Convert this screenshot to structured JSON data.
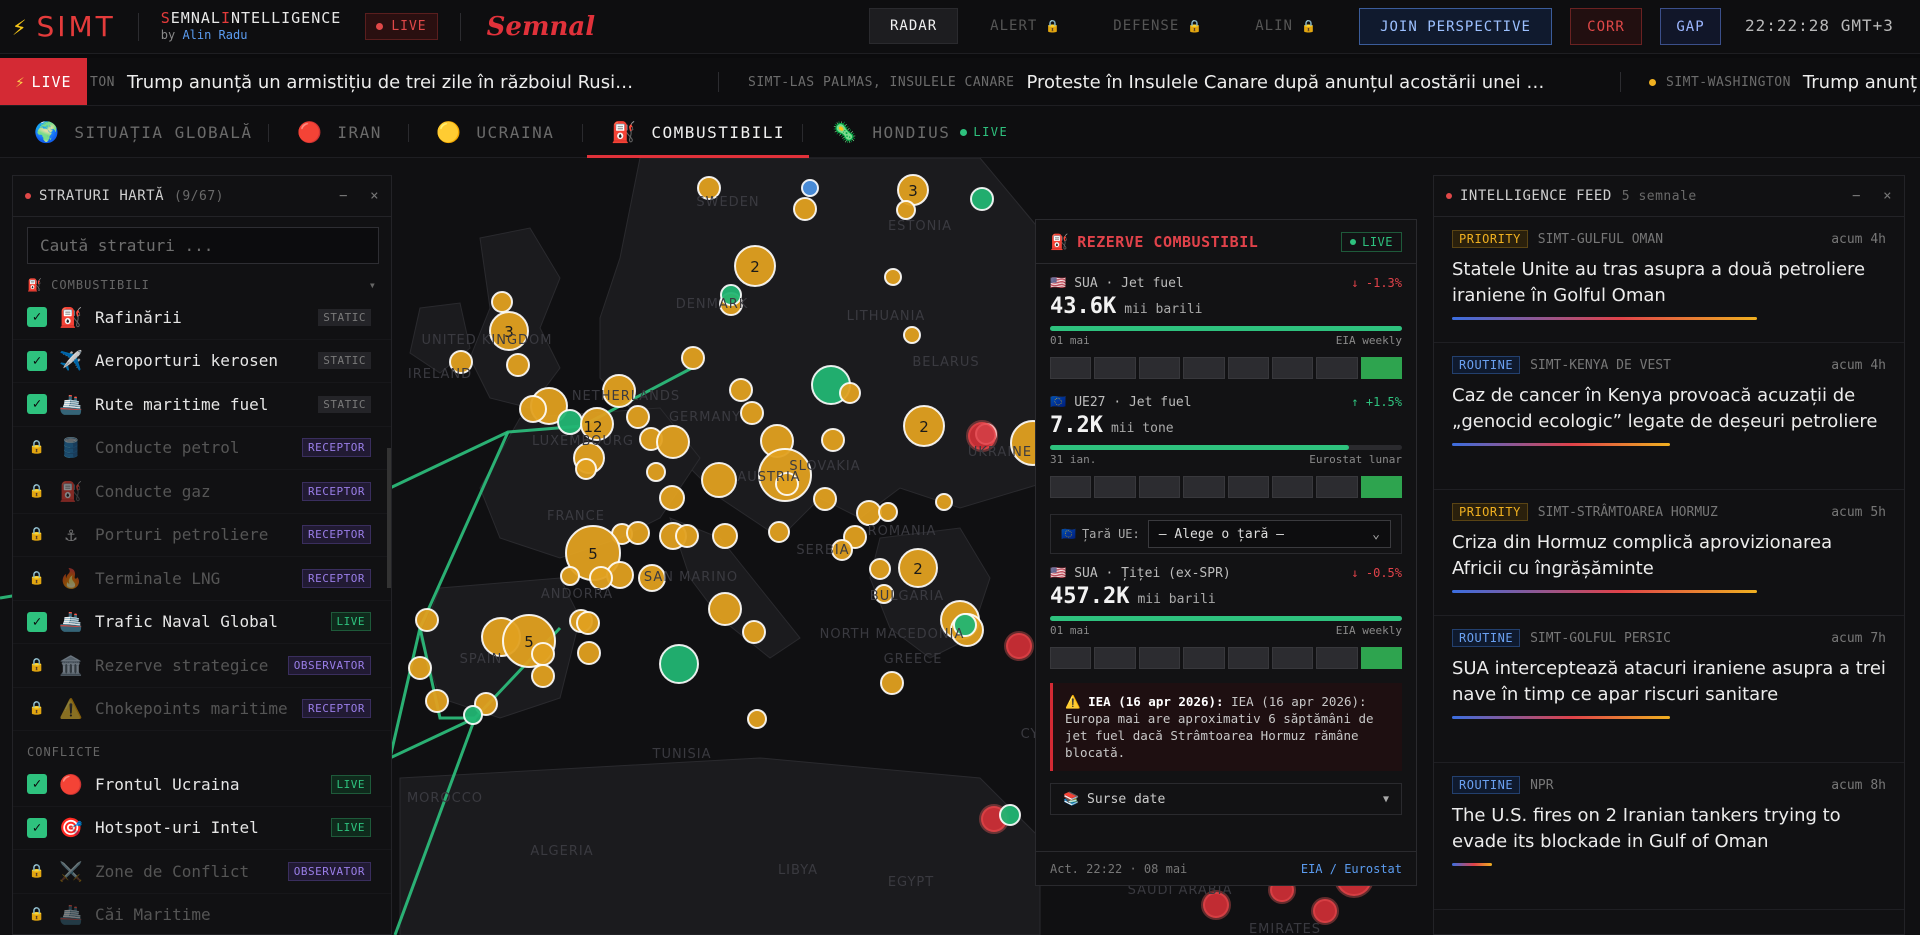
{
  "header": {
    "logo_text": "SIMT",
    "brand_first_s": "S",
    "brand_part1": "EMNAL",
    "brand_first_i": "I",
    "brand_part2": "NTELLIGENCE",
    "by_prefix": "by",
    "author": "Alin Radu",
    "live_label": "LIVE",
    "script_brand": "Semnal",
    "nav": [
      {
        "label": "RADAR",
        "active": true,
        "locked": false
      },
      {
        "label": "ALERT",
        "active": false,
        "locked": true
      },
      {
        "label": "DEFENSE",
        "active": false,
        "locked": true
      },
      {
        "label": "ALIN",
        "active": false,
        "locked": true
      }
    ],
    "join_label": "JOIN PERSPECTIVE",
    "corr_label": "CORR",
    "gap_label": "GAP",
    "clock": "22:22:28 GMT+3"
  },
  "ticker": {
    "live_label": "LIVE",
    "items": [
      {
        "source": "TON",
        "text": "Trump anunță un armistițiu de trei zile în războiul Rusi…"
      },
      {
        "source": "SIMT-LAS PALMAS, INSULELE CANARE",
        "text": "Proteste în Insulele Canare după anunțul acostării unei …"
      },
      {
        "source": "SIMT-WASHINGTON",
        "text": "Trump anunț"
      }
    ]
  },
  "tabs": [
    {
      "icon": "🌍",
      "label": "SITUAȚIA GLOBALĂ",
      "active": false
    },
    {
      "icon": "🔴",
      "label": "IRAN",
      "active": false
    },
    {
      "icon": "🟡",
      "label": "UCRAINA",
      "active": false
    },
    {
      "icon": "⛽",
      "label": "COMBUSTIBILI",
      "active": true
    },
    {
      "icon": "🦠",
      "label": "HONDIUS",
      "active": false,
      "live": "LIVE"
    }
  ],
  "map_labels": [
    "SWEDEN",
    "ESTONIA",
    "DENMARK",
    "LITHUANIA",
    "UNITED KINGDOM",
    "IRELAND",
    "BELARUS",
    "NETHERLANDS",
    "GERMANY",
    "LUXEMBOURG",
    "UKRAINE",
    "SLOVAKIA",
    "AUSTRIA",
    "FRANCE",
    "ROMANIA",
    "SERBIA",
    "SAN MARINO",
    "ANDORRA",
    "BULGARIA",
    "NORTH MACEDONIA",
    "SPAIN",
    "GREECE",
    "TUNISIA",
    "MOROCCO",
    "ALGERIA",
    "LIBYA",
    "EGYPT",
    "SAUDI ARABIA",
    "EMIRATES",
    "CY"
  ],
  "clusters": [
    "3",
    "2",
    "3",
    "12",
    "2",
    "5",
    "5",
    "2"
  ],
  "layers": {
    "title": "STRATURI HARTĂ",
    "count": "(9/67)",
    "minimize": "−",
    "close": "×",
    "search_placeholder": "Caută straturi ...",
    "section1": "⛽ COMBUSTIBILI",
    "section1_caret": "▾",
    "items1": [
      {
        "icon": "⛽",
        "name": "Rafinării",
        "badge": "STATIC",
        "type": "static",
        "on": true
      },
      {
        "icon": "✈️",
        "name": "Aeroporturi kerosen",
        "badge": "STATIC",
        "type": "static",
        "on": true
      },
      {
        "icon": "🚢",
        "name": "Rute maritime fuel",
        "badge": "STATIC",
        "type": "static",
        "on": true
      },
      {
        "icon": "🛢️",
        "name": "Conducte petrol",
        "badge": "RECEPTOR",
        "type": "receptor",
        "on": false
      },
      {
        "icon": "⛽",
        "name": "Conducte gaz",
        "badge": "RECEPTOR",
        "type": "receptor",
        "on": false
      },
      {
        "icon": "⚓",
        "name": "Porturi petroliere",
        "badge": "RECEPTOR",
        "type": "receptor",
        "on": false
      },
      {
        "icon": "🔥",
        "name": "Terminale LNG",
        "badge": "RECEPTOR",
        "type": "receptor",
        "on": false
      },
      {
        "icon": "🚢",
        "name": "Trafic Naval Global",
        "badge": "LIVE",
        "type": "live",
        "on": true
      },
      {
        "icon": "🏛️",
        "name": "Rezerve strategice",
        "badge": "OBSERVATOR",
        "type": "observ",
        "on": false
      },
      {
        "icon": "⚠️",
        "name": "Chokepoints maritime",
        "badge": "RECEPTOR",
        "type": "receptor",
        "on": false
      }
    ],
    "section2": "CONFLICTE",
    "items2": [
      {
        "icon": "🔴",
        "name": "Frontul Ucraina",
        "badge": "LIVE",
        "type": "live",
        "on": true
      },
      {
        "icon": "🎯",
        "name": "Hotspot-uri Intel",
        "badge": "LIVE",
        "type": "live",
        "on": true
      },
      {
        "icon": "⚔️",
        "name": "Zone de Conflict",
        "badge": "OBSERVATOR",
        "type": "observ",
        "on": false
      },
      {
        "icon": "🚢",
        "name": "Căi Maritime",
        "badge": "",
        "type": "",
        "on": false
      }
    ]
  },
  "fuel": {
    "title": "REZERVE COMBUSTIBIL",
    "live": "LIVE",
    "blocks": [
      {
        "flag": "🇺🇸",
        "region": "SUA · Jet fuel",
        "change": "↓ -1.3%",
        "dir": "neg",
        "value": "43.6K",
        "unit": "mii barili",
        "fill": 1.0,
        "date": "01 mai",
        "source": "EIA weekly"
      },
      {
        "flag": "🇪🇺",
        "region": "UE27 · Jet fuel",
        "change": "↑ +1.5%",
        "dir": "pos",
        "value": "7.2K",
        "unit": "mii tone",
        "fill": 0.85,
        "date": "31 ian.",
        "source": "Eurostat lunar"
      }
    ],
    "country_label": "Țară UE:",
    "country_select": "— Alege o țară —",
    "block3": {
      "flag": "🇺🇸",
      "region": "SUA · Țiței (ex-SPR)",
      "change": "↓ -0.5%",
      "dir": "neg",
      "value": "457.2K",
      "unit": "mii barili",
      "fill": 1.0,
      "date": "01 mai",
      "source": "EIA weekly"
    },
    "alert_head": "⚠️ IEA (16 apr 2026):",
    "alert_body": "IEA (16 apr 2026): Europa mai are aproximativ 6 săptămâni de jet fuel dacă Strâmtoarea Hormuz rămâne blocată.",
    "sources_label": "📚 Surse date",
    "sources_caret": "▼",
    "footer_left": "Act. 22:22 · 08 mai",
    "footer_right": "EIA / Eurostat"
  },
  "feed": {
    "title": "INTELLIGENCE FEED",
    "count": "5 semnale",
    "minimize": "−",
    "close": "×",
    "items": [
      {
        "priority": "PRIORITY",
        "source": "SIMT-GULFUL OMAN",
        "ago": "acum 4h",
        "title": "Statele Unite au tras asupra a două petroliere iraniene în Golful Oman"
      },
      {
        "priority": "ROUTINE",
        "source": "SIMT-KENYA DE VEST",
        "ago": "acum 4h",
        "title": "Caz de cancer în Kenya provoacă acuzații de „genocid ecologic” legate de deșeuri petroliere"
      },
      {
        "priority": "PRIORITY",
        "source": "SIMT-STRÂMTOAREA HORMUZ",
        "ago": "acum 5h",
        "title": "Criza din Hormuz complică aprovizionarea Africii cu îngrășăminte"
      },
      {
        "priority": "ROUTINE",
        "source": "SIMT-GOLFUL PERSIC",
        "ago": "acum 7h",
        "title": "SUA interceptează atacuri iraniene asupra a trei nave în timp ce apar riscuri sanitare"
      },
      {
        "priority": "ROUTINE",
        "source": "NPR",
        "ago": "acum 8h",
        "title": "The U.S. fires on 2 Iranian tankers trying to evade its blockade in Gulf of Oman"
      }
    ]
  }
}
